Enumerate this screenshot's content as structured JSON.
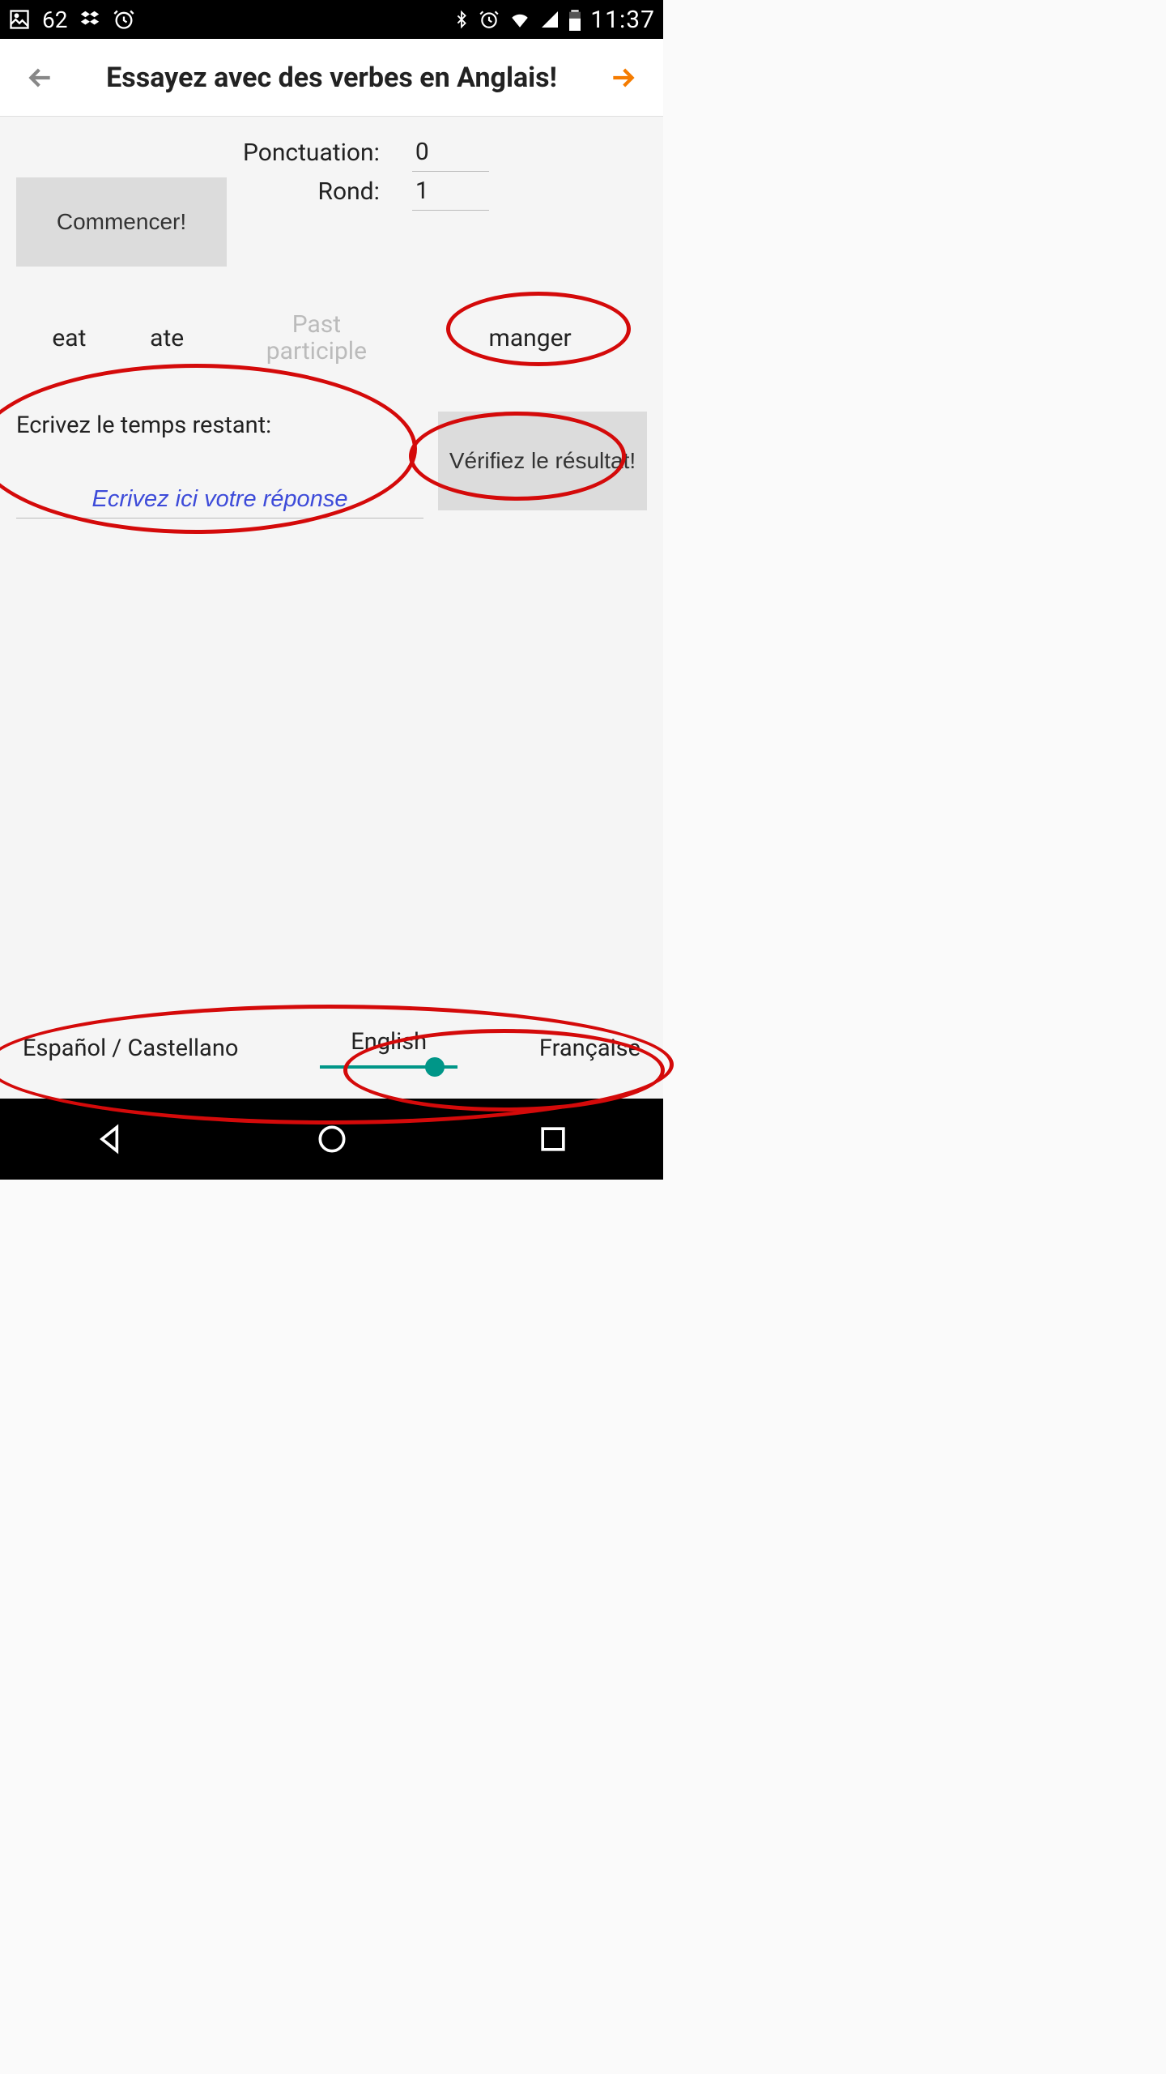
{
  "status_bar": {
    "notif_count": "62",
    "time": "11:37"
  },
  "app_bar": {
    "title": "Essayez avec des verbes en Anglais!"
  },
  "commencer_label": "Commencer!",
  "score": {
    "ponctuation_label": "Ponctuation:",
    "ponctuation_value": "0",
    "rond_label": "Rond:",
    "rond_value": "1"
  },
  "verbs": {
    "base": "eat",
    "past": "ate",
    "participle": "Past participle",
    "translation": "manger"
  },
  "answer": {
    "label": "Ecrivez le temps restant:",
    "placeholder": "Ecrivez ici votre réponse"
  },
  "verify_label": "Vérifiez le résultat!",
  "lang": {
    "left": "Español / Castellano",
    "center": "English",
    "right": "Française"
  }
}
